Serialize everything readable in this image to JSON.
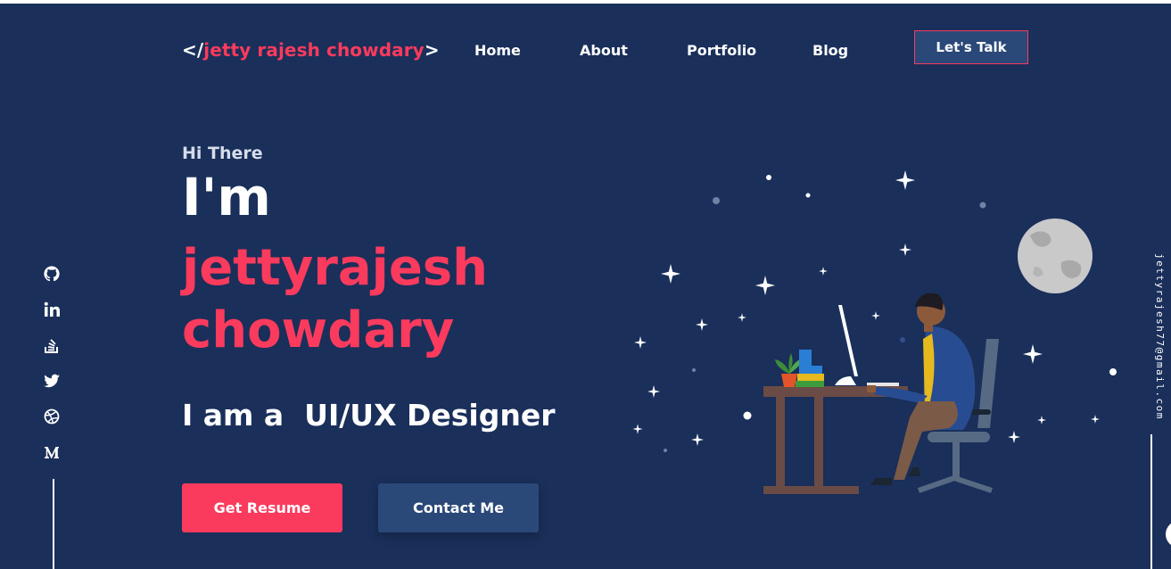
{
  "nav": {
    "logo_open": "</",
    "logo_name": "jetty rajesh chowdary",
    "logo_close": ">",
    "links": [
      {
        "label": "Home"
      },
      {
        "label": "About"
      },
      {
        "label": "Portfolio"
      },
      {
        "label": "Blog"
      }
    ],
    "cta_label": "Let's Talk"
  },
  "hero": {
    "greeting": "Hi There",
    "im": "I'm",
    "name_line1": "jettyrajesh",
    "name_line2": "chowdary",
    "role": "I am a  UI/UX Designer",
    "resume_label": "Get Resume",
    "contact_label": "Contact Me"
  },
  "social": [
    {
      "icon": "github-icon"
    },
    {
      "icon": "linkedin-icon"
    },
    {
      "icon": "stackoverflow-icon"
    },
    {
      "icon": "twitter-icon"
    },
    {
      "icon": "dribbble-icon"
    },
    {
      "icon": "medium-icon"
    }
  ],
  "email": "jettyrajesh77@gmail.com",
  "colors": {
    "background": "#1a2f5a",
    "accent": "#fb3b5d",
    "button_secondary": "#2a4878",
    "text": "#ffffff"
  }
}
